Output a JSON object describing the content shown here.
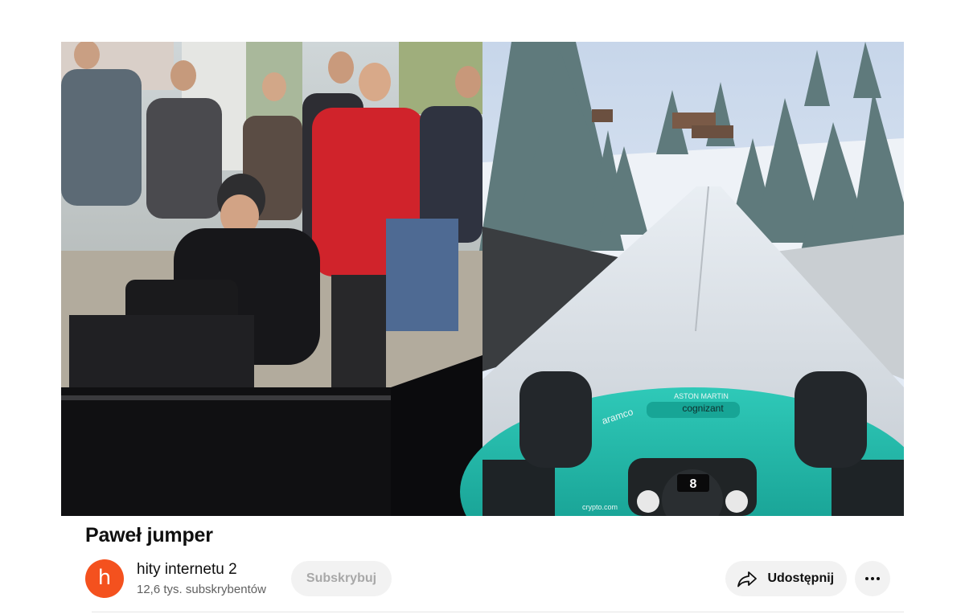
{
  "video": {
    "title": "Paweł jumper",
    "thumbnail_left": "photo-of-people-watching-racing-simulator",
    "thumbnail_right": "ski-jump-game-from-f1-cockpit",
    "overlay_texts": {
      "sponsor_1": "ASTON MARTIN",
      "sponsor_2": "cognizant",
      "sponsor_3": "aramco",
      "sponsor_4": "crypto.com",
      "speed": "8"
    }
  },
  "channel": {
    "avatar_letter": "h",
    "avatar_color": "#f4511e",
    "name": "hity internetu 2",
    "subscribers": "12,6 tys. subskrybentów"
  },
  "actions": {
    "subscribe_label": "Subskrybuj",
    "share_label": "Udostępnij",
    "share_icon": "share-icon",
    "more_icon": "more-horizontal-icon"
  },
  "colors": {
    "accent_teal": "#1fb5a6",
    "subscribe_disabled_text": "#a8a8a8"
  }
}
